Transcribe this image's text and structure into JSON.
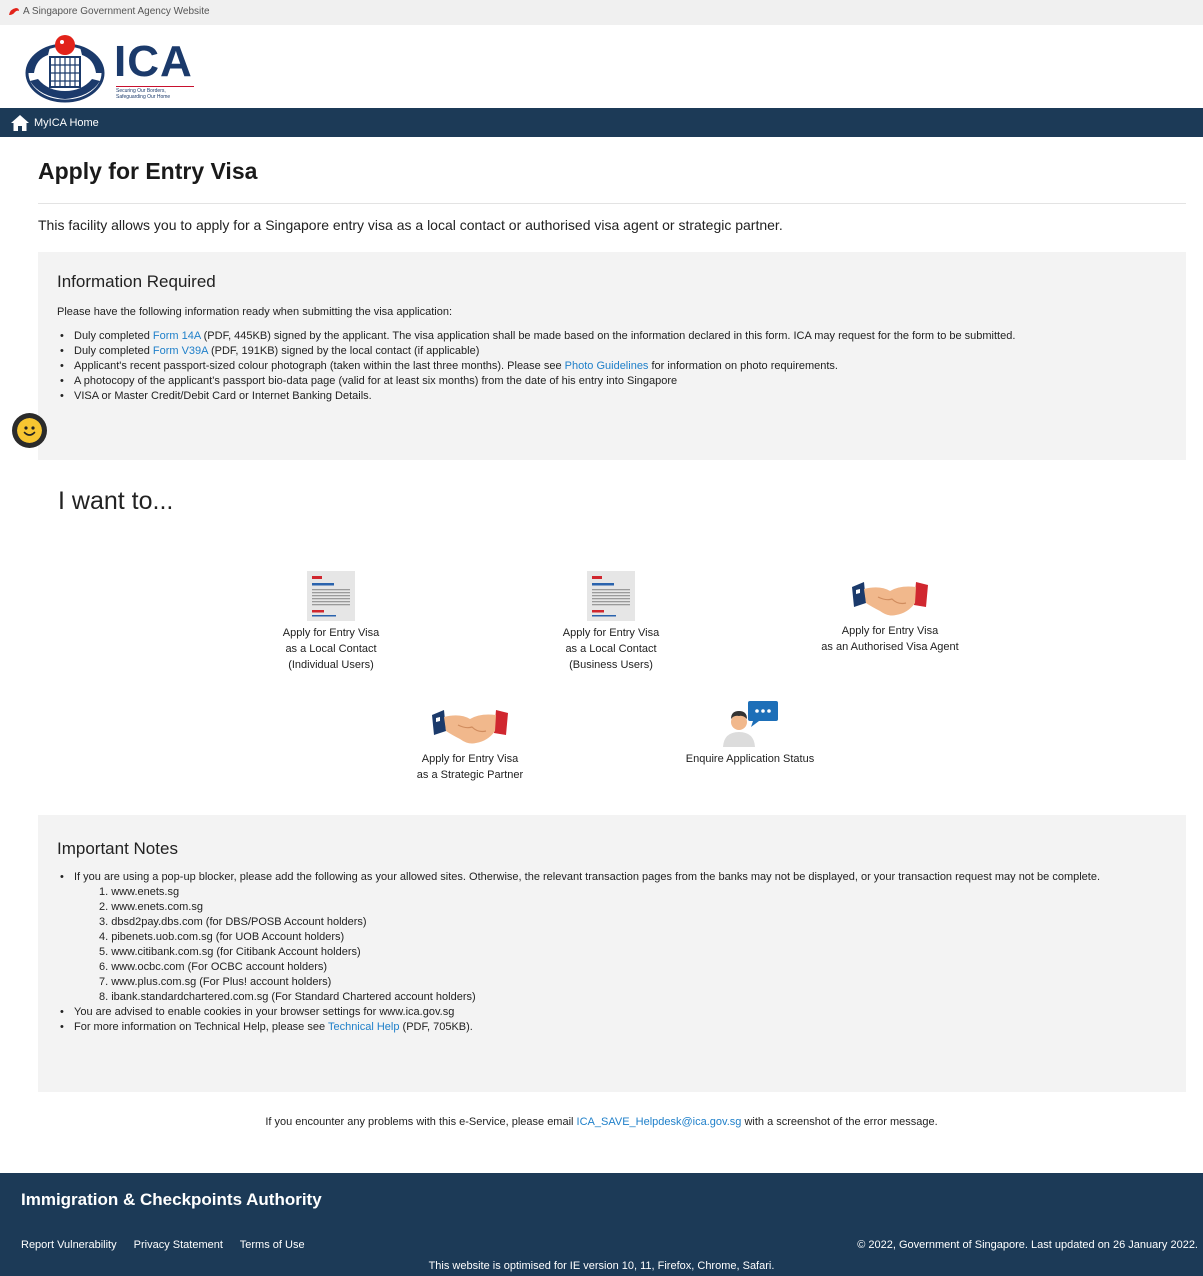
{
  "gov_bar": {
    "text": "A Singapore Government Agency Website"
  },
  "logo": {
    "name": "ICA",
    "tagline_1": "Securing Our Borders,",
    "tagline_2": "Safeguarding Our Home"
  },
  "nav": {
    "home_label": "MyICA Home"
  },
  "page": {
    "title": "Apply for Entry Visa",
    "intro": "This facility allows you to apply for a Singapore entry visa as a local contact or authorised visa agent or strategic partner."
  },
  "info": {
    "heading": "Information Required",
    "lead": "Please have the following information ready when submitting the visa application:",
    "item1_pre": "Duly completed ",
    "item1_link": "Form 14A",
    "item1_post": " (PDF, 445KB) signed by the applicant. The visa application shall be made based on the information declared in this form. ICA may request for the form to be submitted.",
    "item2_pre": "Duly completed ",
    "item2_link": "Form V39A",
    "item2_post": " (PDF, 191KB) signed by the local contact (if applicable)",
    "item3_pre": "Applicant's recent passport-sized colour photograph (taken within the last three months). Please see ",
    "item3_link": "Photo Guidelines",
    "item3_post": " for information on photo requirements.",
    "item4": "A photocopy of the applicant's passport bio-data page (valid for at least six months) from the date of his entry into Singapore",
    "item5": "VISA or Master Credit/Debit Card or Internet Banking Details."
  },
  "want": {
    "heading": "I want to...",
    "tiles": [
      {
        "line1": "Apply for Entry Visa",
        "line2": "as a Local Contact",
        "line3": "(Individual Users)"
      },
      {
        "line1": "Apply for Entry Visa",
        "line2": "as a Local Contact",
        "line3": "(Business Users)"
      },
      {
        "line1": "Apply for Entry Visa",
        "line2": "as an Authorised Visa Agent"
      },
      {
        "line1": "Apply for Entry Visa",
        "line2": "as a Strategic Partner"
      },
      {
        "line1": "Enquire Application Status"
      }
    ]
  },
  "notes": {
    "heading": "Important Notes",
    "item1": "If you are using a pop-up blocker, please add the following as your allowed sites. Otherwise, the relevant transaction pages from the banks may not be displayed, or your transaction request may not be complete.",
    "sites": [
      "1. www.enets.sg",
      "2. www.enets.com.sg",
      "3. dbsd2pay.dbs.com (for DBS/POSB Account holders)",
      "4. pibenets.uob.com.sg (for UOB Account holders)",
      "5. www.citibank.com.sg (for Citibank Account holders)",
      "6. www.ocbc.com (For OCBC account holders)",
      "7. www.plus.com.sg (For Plus! account holders)",
      "8. ibank.standardchartered.com.sg (For Standard Chartered account holders)"
    ],
    "item2": "You are advised to enable cookies in your browser settings for www.ica.gov.sg",
    "item3_pre": "For more information on Technical Help, please see ",
    "item3_link": "Technical Help",
    "item3_post": " (PDF, 705KB)."
  },
  "help": {
    "pre": "If you encounter any problems with this e-Service, please email ",
    "email": "ICA_SAVE_Helpdesk@ica.gov.sg",
    "post": " with a screenshot of the error message."
  },
  "footer": {
    "title": "Immigration & Checkpoints Authority",
    "links": [
      "Report Vulnerability",
      "Privacy Statement",
      "Terms of Use"
    ],
    "copyright": "© 2022, Government of Singapore. Last updated on 26 January 2022.",
    "optimised": "This website is optimised for IE version 10, 11, Firefox, Chrome, Safari."
  },
  "colors": {
    "nav": "#1c3a57",
    "link": "#1e7fc9",
    "panel": "#f3f3f3",
    "accent_red": "#c8102e"
  }
}
